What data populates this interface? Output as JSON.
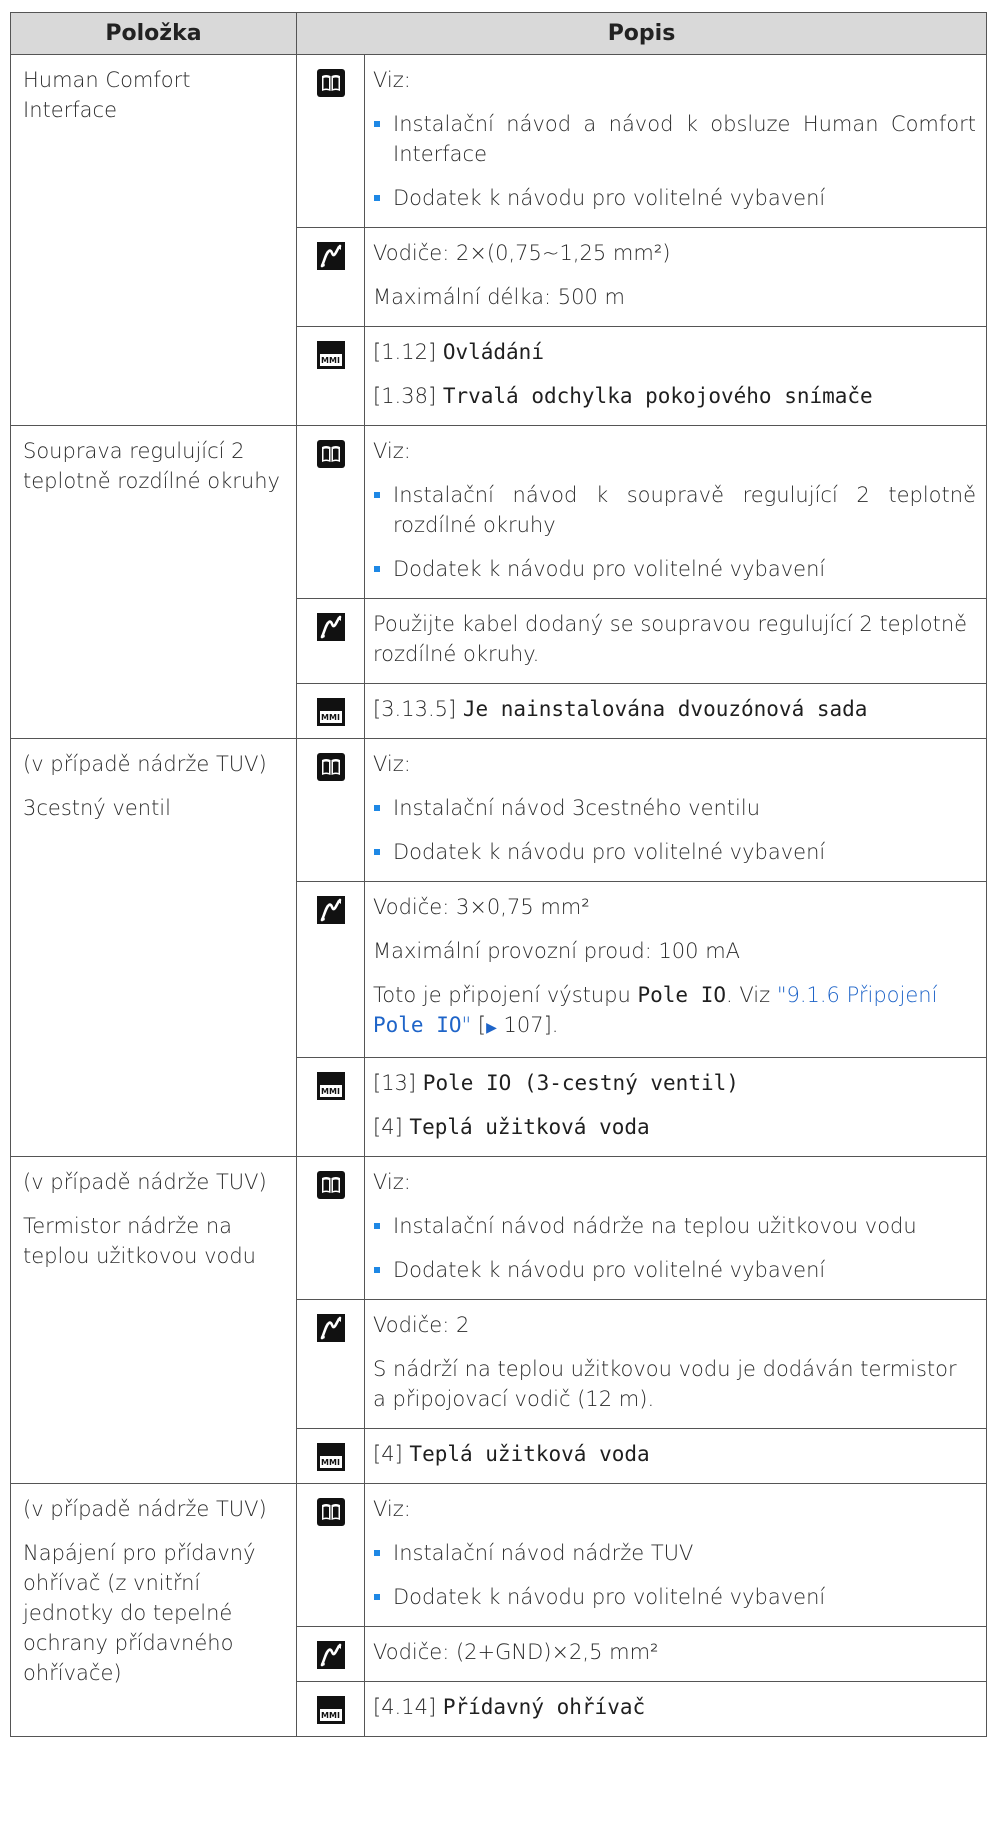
{
  "header": {
    "item": "Položka",
    "description": "Popis"
  },
  "rows": [
    {
      "item": [
        "Human Comfort Interface"
      ],
      "book": {
        "intro": "Viz:",
        "bullets": [
          "Instalační návod a návod k obsluze Human Comfort Interface",
          "Dodatek k návodu pro volitelné vybavení"
        ]
      },
      "wire": [
        "Vodiče: 2×(0,75~1,25 mm²)",
        "Maximální délka: 500 m"
      ],
      "mmi": [
        {
          "code": "[1.12] ",
          "name": "Ovládání"
        },
        {
          "code": "[1.38] ",
          "name": "Trvalá odchylka pokojového snímače"
        }
      ]
    },
    {
      "item": [
        "Souprava regulující 2 teplotně rozdílné okruhy"
      ],
      "book": {
        "intro": "Viz:",
        "bullets": [
          "Instalační návod k soupravě regulující 2 teplotně rozdílné okruhy",
          "Dodatek k návodu pro volitelné vybavení"
        ]
      },
      "wire": [
        "Použijte kabel dodaný se soupravou regulující 2 teplotně rozdílné okruhy."
      ],
      "mmi": [
        {
          "code": "[3.13.5] ",
          "name": "Je nainstalována dvouzónová sada"
        }
      ]
    },
    {
      "item": [
        "(v případě nádrže TUV)",
        "3cestný ventil"
      ],
      "book": {
        "intro": "Viz:",
        "bullets": [
          "Instalační návod 3cestného ventilu",
          "Dodatek k návodu pro volitelné vybavení"
        ]
      },
      "wire": [
        "Vodiče: 3×0,75 mm²",
        "Maximální provozní proud: 100 mA"
      ],
      "wire_ref": {
        "pre": "Toto je připojení výstupu ",
        "mono": "Pole IO",
        "mid": ". Viz ",
        "link_pre": "\"9.1.6 Připojení ",
        "link_mono": "Pole IO",
        "link_post": "\"",
        "page_pre": " [",
        "arrow": "▶",
        "page": " 107].",
        "link_color": "#1e64c8"
      },
      "mmi": [
        {
          "code": "[13] ",
          "name": "Pole IO",
          "extra": " (3-cestný ventil)"
        },
        {
          "code": "[4] ",
          "name": "Teplá užitková voda"
        }
      ]
    },
    {
      "item": [
        "(v případě nádrže TUV)",
        "Termistor nádrže na teplou užitkovou vodu"
      ],
      "book": {
        "intro": "Viz:",
        "bullets": [
          "Instalační návod nádrže na teplou užitkovou vodu",
          "Dodatek k návodu pro volitelné vybavení"
        ]
      },
      "wire": [
        "Vodiče: 2",
        "S nádrží na teplou užitkovou vodu je dodáván termistor a připojovací vodič (12 m)."
      ],
      "mmi": [
        {
          "code": "[4] ",
          "name": "Teplá užitková voda"
        }
      ]
    },
    {
      "item": [
        "(v případě nádrže TUV)",
        "Napájení pro přídavný ohřívač (z vnitřní jednotky do tepelné ochrany přídavného ohřívače)"
      ],
      "book": {
        "intro": "Viz:",
        "bullets": [
          "Instalační návod nádrže TUV",
          "Dodatek k návodu pro volitelné vybavení"
        ]
      },
      "wire": [
        "Vodiče: (2+GND)×2,5 mm²"
      ],
      "mmi": [
        {
          "code": "[4.14] ",
          "name": "Přídavný ohřívač"
        }
      ]
    }
  ],
  "icons": {
    "book": "manual-book-icon",
    "wire": "wiring-icon",
    "mmi": "mmi-user-interface-icon",
    "mmi_label": "MMI"
  }
}
